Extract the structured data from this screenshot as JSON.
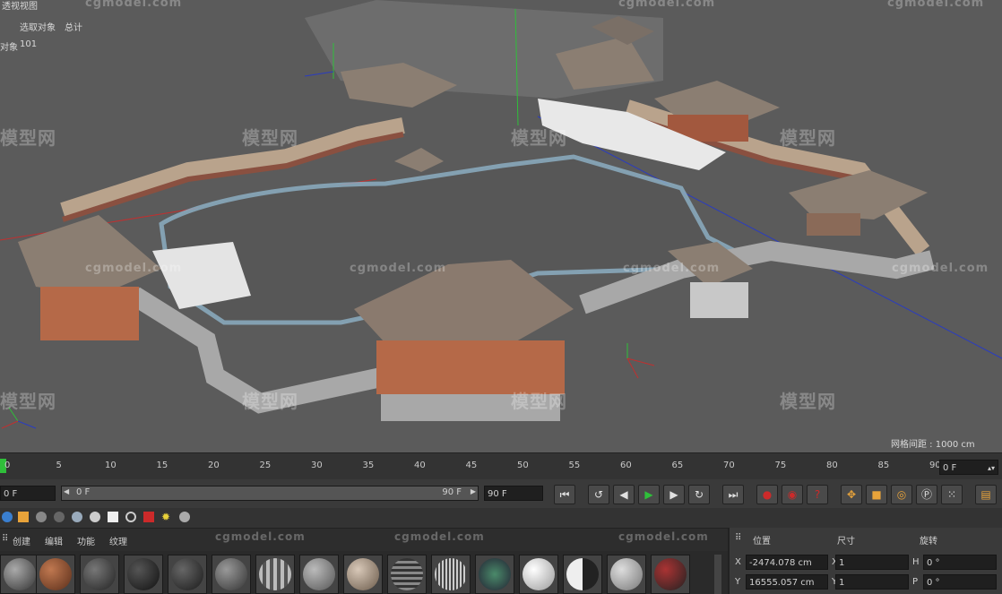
{
  "viewport": {
    "title_fragment": "透视视图",
    "stats_header_a": "选取对象",
    "stats_header_b": "总计",
    "stats_row_label": "对象",
    "stats_row_value": "101",
    "grid_spacing": "网格间距 : 1000 cm",
    "watermark_cn": "模型网",
    "watermark_en": "cgmodel.com"
  },
  "timeline": {
    "ticks": [
      "0",
      "5",
      "10",
      "15",
      "20",
      "25",
      "30",
      "35",
      "40",
      "45",
      "50",
      "55",
      "60",
      "65",
      "70",
      "75",
      "80",
      "85",
      "90"
    ],
    "current_frame": "0 F"
  },
  "transport": {
    "start_field": "0 F",
    "range_start": "0 F",
    "range_end": "90 F",
    "end_field": "90 F"
  },
  "material_menu": {
    "create": "创建",
    "edit": "编辑",
    "function": "功能",
    "texture": "纹理"
  },
  "attributes": {
    "tab_position": "位置",
    "tab_size": "尺寸",
    "tab_rotation": "旋转",
    "x_label": "X",
    "x_value": "-2474.078 cm",
    "y_label": "Y",
    "y_value": "16555.057 cm",
    "sx_label": "X",
    "sx_value": "1",
    "sy_label": "Y",
    "sy_value": "1",
    "h_label": "H",
    "h_value": "0 °",
    "p_label": "P",
    "p_value": "0 °"
  },
  "colors": {
    "viewport_bg": "#5b5b5b",
    "accent_orange": "#e8a33a",
    "play_green": "#2fbf3a",
    "record_red": "#cc2a2a"
  }
}
